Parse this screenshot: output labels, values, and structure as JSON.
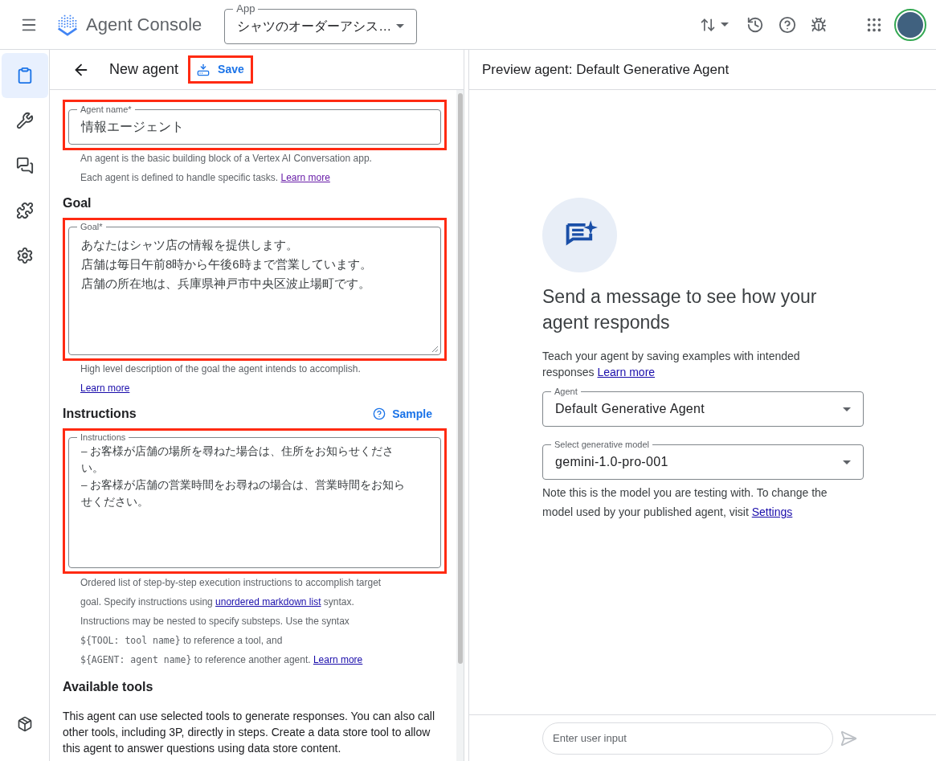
{
  "header": {
    "product": "Agent Console",
    "app_select": {
      "label": "App",
      "value": "シャツのオーダーアシス…"
    }
  },
  "sidebar": {
    "items": [
      {
        "kind": "clipboard",
        "selected": true
      },
      {
        "kind": "wrench",
        "selected": false
      },
      {
        "kind": "chat",
        "selected": false
      },
      {
        "kind": "puzzle",
        "selected": false
      },
      {
        "kind": "gear",
        "selected": false
      }
    ]
  },
  "editor": {
    "title": "New agent",
    "save": "Save",
    "name_field": {
      "label": "Agent name*",
      "value": "情報エージェント",
      "highlighted": true,
      "help": [
        {
          "kind": "text",
          "text": " An agent is the basic building block of a Vertex AI Conversation app."
        },
        {
          "kind": "break"
        },
        {
          "kind": "text",
          "text": "Each agent is defined to handle specific tasks. "
        },
        {
          "kind": "visited",
          "text": "Learn more"
        }
      ]
    },
    "goal": {
      "heading": "Goal",
      "label": "Goal*",
      "lines": [
        "あなたはシャツ店の情報を提供します。",
        "店舗は毎日午前8時から午後6時まで営業しています。",
        "店舗の所在地は、兵庫県神戸市中央区波止場町です。"
      ],
      "highlighted": true,
      "help": [
        {
          "kind": "text",
          "text": " High level description of the goal the agent intends to accomplish."
        },
        {
          "kind": "break"
        },
        {
          "kind": "link",
          "text": "Learn more"
        }
      ]
    },
    "instructions": {
      "heading": "Instructions",
      "sample": "Sample",
      "label": "Instructions",
      "lines": [
        "–  お客様が店舗の場所を尋ねた場合は、住所をお知らせくださ",
        "い。",
        "–  お客様が店舗の営業時間をお尋ねの場合は、営業時間をお知ら",
        "せください。"
      ],
      "highlighted": true,
      "help": [
        {
          "kind": "text",
          "text": " Ordered list of step-by-step execution instructions to accomplish target"
        },
        {
          "kind": "break"
        },
        {
          "kind": "text",
          "text": "goal. Specify instructions using "
        },
        {
          "kind": "link",
          "text": "unordered markdown list"
        },
        {
          "kind": "text",
          "text": " syntax."
        },
        {
          "kind": "break"
        },
        {
          "kind": "text",
          "text": "Instructions may be nested to specify substeps. Use the syntax"
        },
        {
          "kind": "break"
        },
        {
          "kind": "code",
          "text": "${TOOL: tool name}"
        },
        {
          "kind": "text",
          "text": " to reference a tool, and"
        },
        {
          "kind": "break"
        },
        {
          "kind": "code",
          "text": "${AGENT: agent name}"
        },
        {
          "kind": "text",
          "text": " to reference another agent. "
        },
        {
          "kind": "link",
          "text": "Learn more"
        }
      ]
    },
    "tools": {
      "heading": "Available tools",
      "text": "This agent can use selected tools to generate responses. You can also call other tools, including 3P, directly in steps. Create a data store tool to allow this agent to answer questions using data store content."
    }
  },
  "preview": {
    "title": "Preview agent: Default Generative Agent",
    "heading": "Send a message to see how your agent responds",
    "teach": "Teach your agent by saving examples with intended responses ",
    "teach_link": "Learn more",
    "agent_select": {
      "label": "Agent",
      "value": "Default Generative Agent"
    },
    "model_select": {
      "label": "Select generative model",
      "value": "gemini-1.0-pro-001"
    },
    "note": "Note this is the model you are testing with. To change the model used by your published agent, visit ",
    "note_link": "Settings",
    "input": {
      "placeholder": "Enter user input"
    }
  }
}
